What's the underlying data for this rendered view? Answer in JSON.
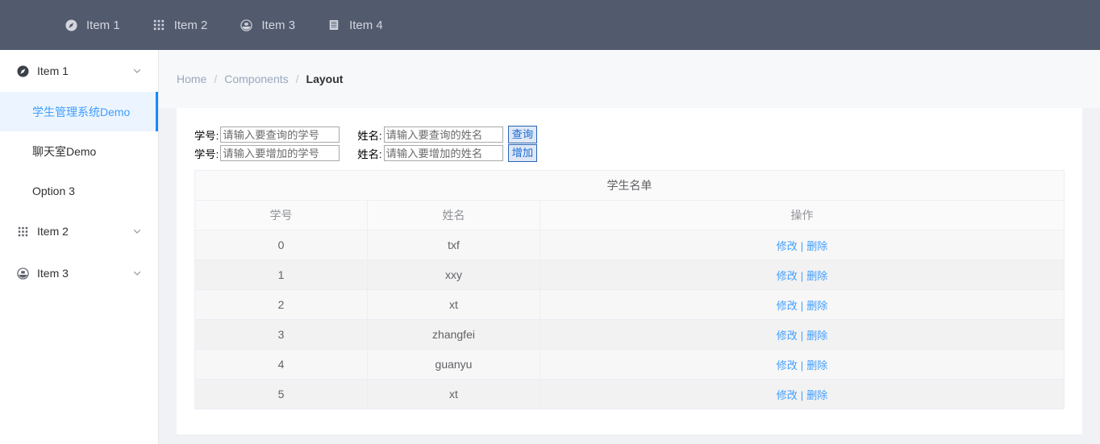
{
  "navbar": {
    "items": [
      {
        "label": "Item 1",
        "icon": "location-icon"
      },
      {
        "label": "Item 2",
        "icon": "grid-menu-icon"
      },
      {
        "label": "Item 3",
        "icon": "document-circle-icon"
      },
      {
        "label": "Item 4",
        "icon": "list-icon"
      }
    ]
  },
  "sidebar": {
    "groups": [
      {
        "label": "Item 1",
        "icon": "location-icon",
        "expanded": true,
        "arrow": "chevron-up-icon",
        "children": [
          {
            "label": "学生管理系统Demo",
            "active": true
          },
          {
            "label": "聊天室Demo",
            "active": false
          },
          {
            "label": "Option 3",
            "active": false
          }
        ]
      },
      {
        "label": "Item 2",
        "icon": "grid-menu-icon",
        "expanded": false,
        "arrow": "chevron-down-icon",
        "children": []
      },
      {
        "label": "Item 3",
        "icon": "document-circle-icon",
        "expanded": false,
        "arrow": "chevron-down-icon",
        "children": []
      }
    ]
  },
  "breadcrumb": {
    "home": "Home",
    "components": "Components",
    "current": "Layout",
    "separator": "/"
  },
  "query_form": {
    "id_label": "学号:",
    "id_placeholder": "请输入要查询的学号",
    "id_value": "",
    "name_label": "姓名:",
    "name_placeholder": "请输入要查询的姓名",
    "name_value": "",
    "submit_label": "查询"
  },
  "add_form": {
    "id_label": "学号:",
    "id_placeholder": "请输入要增加的学号",
    "id_value": "",
    "name_label": "姓名:",
    "name_placeholder": "请输入要增加的姓名",
    "name_value": "",
    "submit_label": "增加"
  },
  "table": {
    "group_header": "学生名单",
    "columns": [
      "学号",
      "姓名",
      "操作"
    ],
    "action_edit": "修改",
    "action_sep": "|",
    "action_delete": "删除",
    "rows": [
      {
        "id": "0",
        "name": "txf"
      },
      {
        "id": "1",
        "name": "xxy"
      },
      {
        "id": "2",
        "name": "xt"
      },
      {
        "id": "3",
        "name": "zhangfei"
      },
      {
        "id": "4",
        "name": "guanyu"
      },
      {
        "id": "5",
        "name": "xt"
      }
    ]
  },
  "colors": {
    "navbar_bg": "#525a6e",
    "accent": "#409EFF",
    "active_bar": "#1989fa",
    "active_item_bg": "#ecf5ff",
    "page_bg": "#f0f2f5",
    "card_bg": "#ffffff"
  }
}
